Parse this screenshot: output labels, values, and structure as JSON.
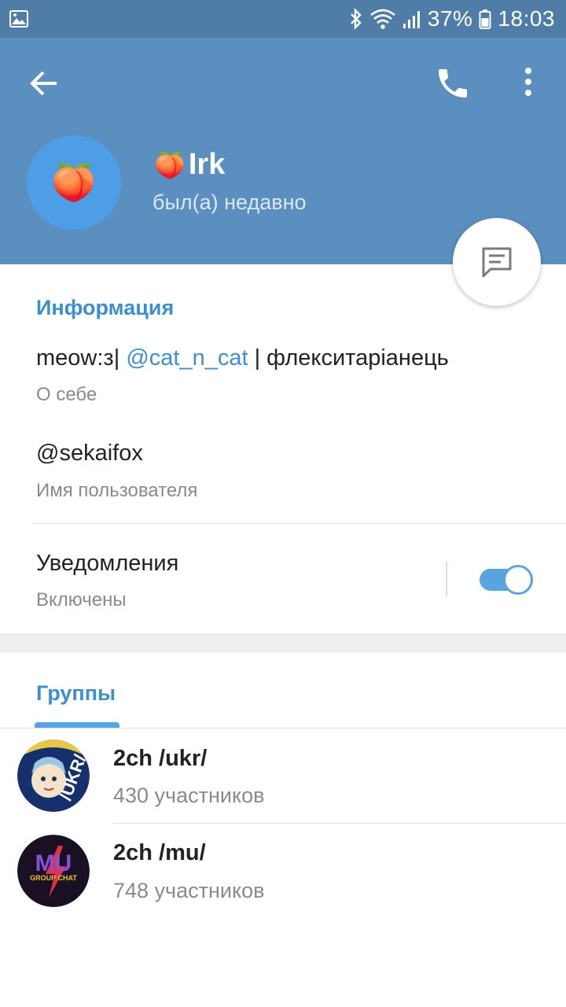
{
  "status_bar": {
    "battery_percent": "37%",
    "time": "18:03",
    "icons": [
      "gallery-icon",
      "bluetooth-icon",
      "wifi-icon",
      "cell-signal-icon",
      "battery-icon"
    ]
  },
  "header": {
    "back_icon": "arrow-left-icon",
    "call_icon": "phone-icon",
    "more_icon": "more-vertical-icon",
    "avatar_emoji": "🍑",
    "name_emoji": "🍑",
    "name": "Irk",
    "status": "был(а) недавно",
    "colors": {
      "header_bg": "#5b8fbf",
      "status_bar_bg": "#4f7da8",
      "avatar_bg": "#4d9ee6",
      "accent": "#3e8fcc"
    }
  },
  "fab": {
    "icon": "message-icon"
  },
  "info": {
    "section_title": "Информация",
    "bio": {
      "before_mention": "meow:з| ",
      "mention": "@cat_n_cat",
      "after_mention": " | флекситаріанець",
      "label": "О себе"
    },
    "username": {
      "value": "@sekaifox",
      "label": "Имя пользователя"
    },
    "notifications": {
      "title": "Уведомления",
      "value": "Включены",
      "enabled": true
    }
  },
  "groups": {
    "section_title": "Группы",
    "items": [
      {
        "name": "2ch /ukr/",
        "members": "430 участников",
        "avatar_text": "/UKR/"
      },
      {
        "name": "2ch /mu/",
        "members": "748 участников",
        "avatar_text": "MU",
        "avatar_subtext": "GROUP CHAT"
      }
    ]
  }
}
